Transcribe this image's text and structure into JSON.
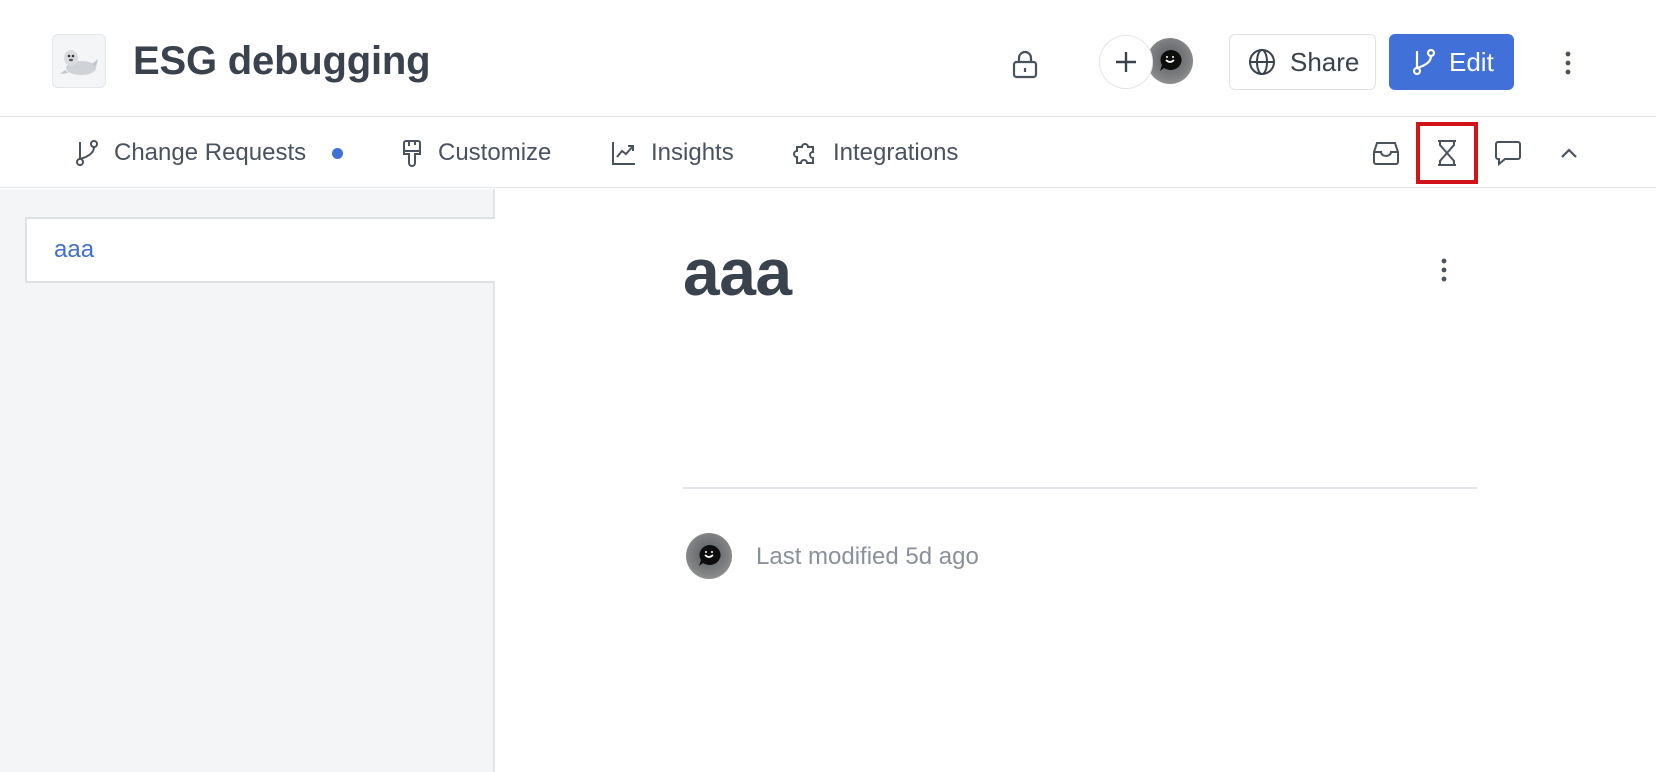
{
  "header": {
    "space_title": "ESG debugging",
    "logo_icon": "seal-logo",
    "share_label": "Share",
    "edit_label": "Edit",
    "accent_color": "#4170d8"
  },
  "toolbar": {
    "tabs": [
      {
        "label": "Change Requests",
        "icon": "git-branch-icon",
        "has_indicator": true
      },
      {
        "label": "Customize",
        "icon": "paintbrush-icon"
      },
      {
        "label": "Insights",
        "icon": "trending-up-icon"
      },
      {
        "label": "Integrations",
        "icon": "puzzle-icon"
      }
    ],
    "right_icons": [
      "inbox-icon",
      "hourglass-icon",
      "comment-icon",
      "chevron-up-icon"
    ],
    "highlighted_icon": "hourglass-icon",
    "highlight_color": "#d0141a"
  },
  "sidebar": {
    "items": [
      {
        "label": "aaa"
      }
    ]
  },
  "page": {
    "title": "aaa",
    "last_modified": "Last modified 5d ago"
  }
}
